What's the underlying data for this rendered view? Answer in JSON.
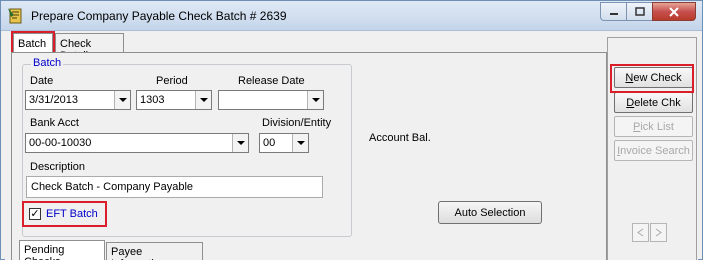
{
  "window": {
    "title": "Prepare Company Payable Check Batch # 2639"
  },
  "tabs": {
    "batch": "Batch",
    "check_detail": "Check Detail"
  },
  "batch_group": {
    "legend": "Batch",
    "date_label": "Date",
    "date_value": "3/31/2013",
    "period_label": "Period",
    "period_value": "1303",
    "release_date_label": "Release Date",
    "release_date_value": "",
    "bank_acct_label": "Bank Acct",
    "bank_acct_value": "00-00-10030",
    "division_label": "Division/Entity",
    "division_value": "00",
    "description_label": "Description",
    "description_value": "Check Batch - Company Payable",
    "eft_batch_label": "EFT Batch",
    "eft_batch_checked": true
  },
  "account_bal_label": "Account Bal.",
  "auto_selection_label": "Auto Selection",
  "bottom_tabs": {
    "pending_checks": "Pending Checks",
    "payee_information": "Payee Information"
  },
  "sidebar": {
    "new_check": "New Check",
    "delete_chk": "Delete Chk",
    "pick_list": "Pick List",
    "invoice_search": "Invoice Search"
  },
  "colors": {
    "highlight": "#d9202a",
    "legend_blue": "#0000cc"
  }
}
